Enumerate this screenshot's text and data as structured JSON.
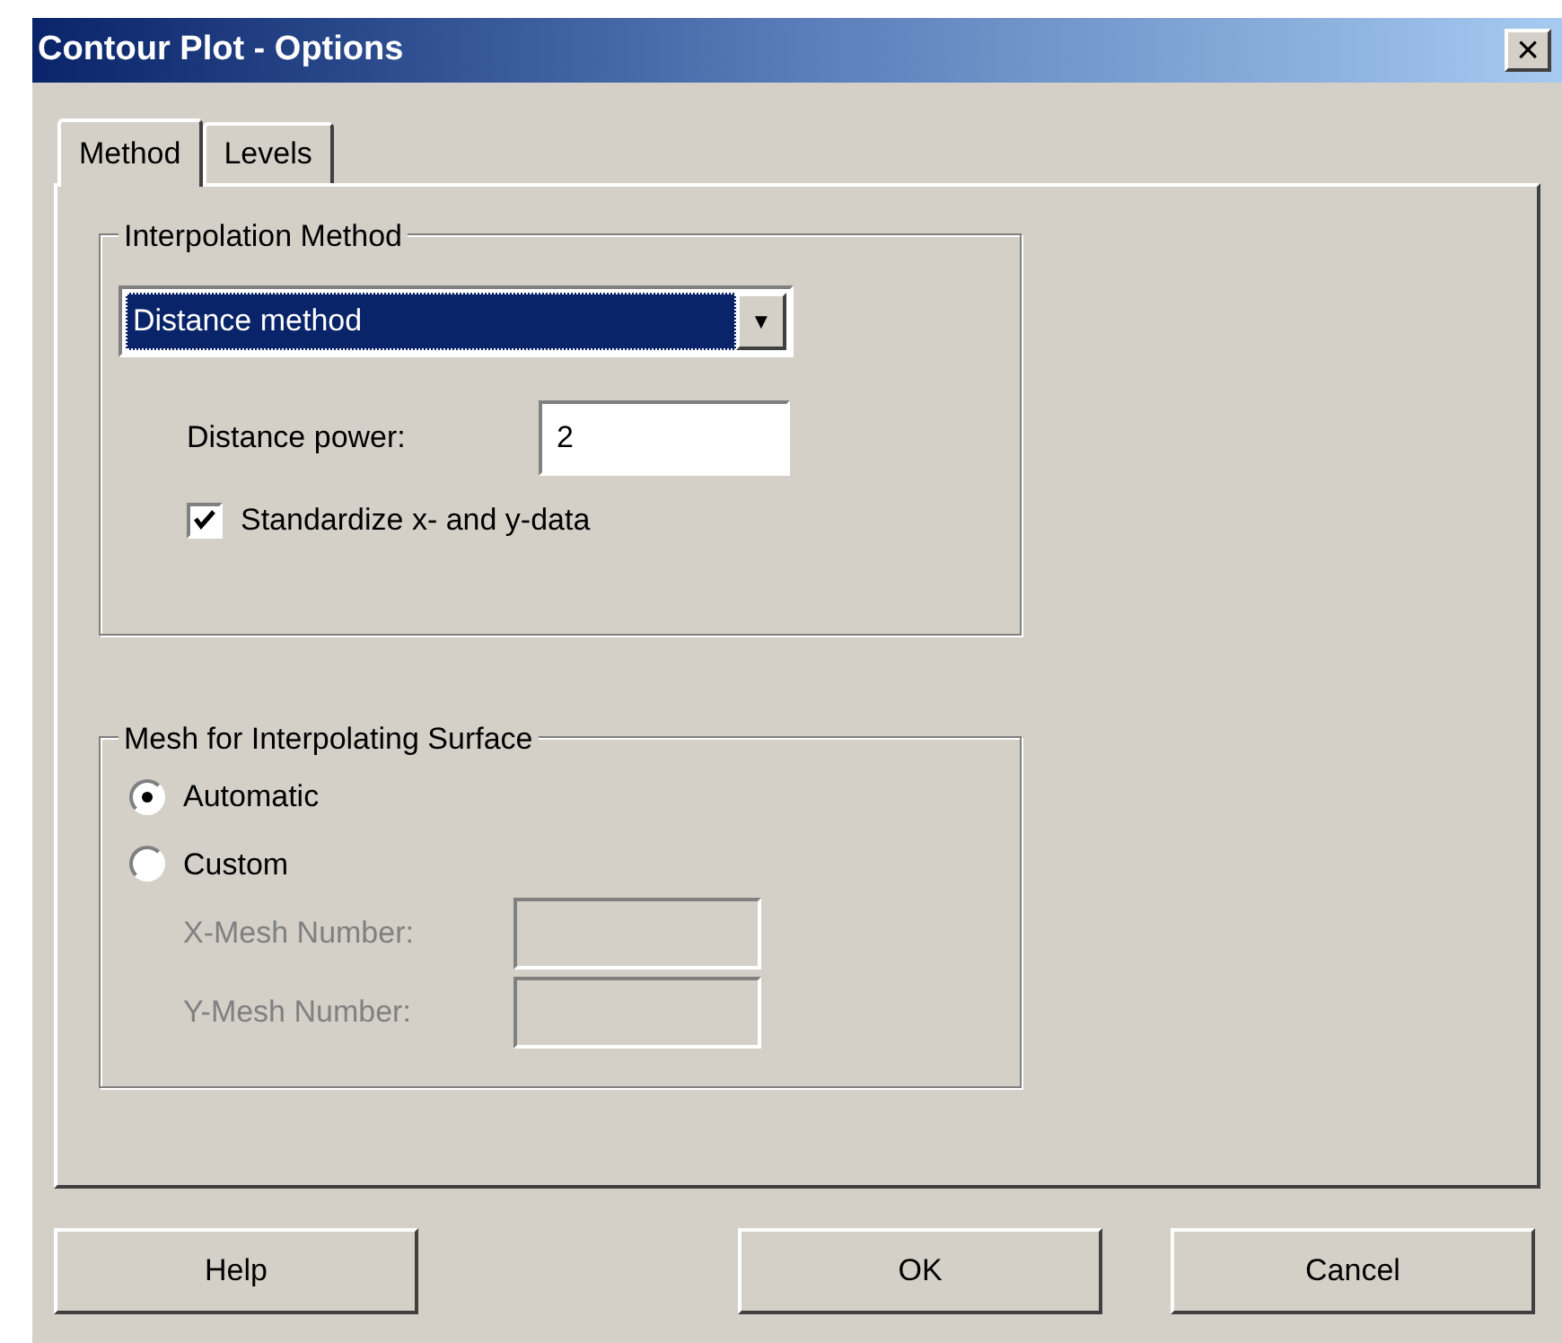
{
  "window": {
    "title": "Contour Plot - Options",
    "close": "×"
  },
  "tabs": [
    {
      "label": "Method",
      "selected": true
    },
    {
      "label": "Levels",
      "selected": false
    }
  ],
  "interpolation": {
    "title": "Interpolation Method",
    "dropdown": {
      "value": "Distance method",
      "arrow": "▼"
    },
    "power": {
      "label": "Distance power:",
      "value": "2"
    },
    "standardize": {
      "label": "Standardize x- and y-data",
      "checked": true
    }
  },
  "mesh": {
    "title": "Mesh for Interpolating Surface",
    "options": [
      {
        "label": "Automatic",
        "selected": true
      },
      {
        "label": "Custom",
        "selected": false
      }
    ],
    "fields": [
      {
        "label": "X-Mesh Number:",
        "disabled": true
      },
      {
        "label": "Y-Mesh Number:",
        "disabled": true
      }
    ]
  },
  "buttons": [
    "Help",
    "OK",
    "Cancel"
  ]
}
